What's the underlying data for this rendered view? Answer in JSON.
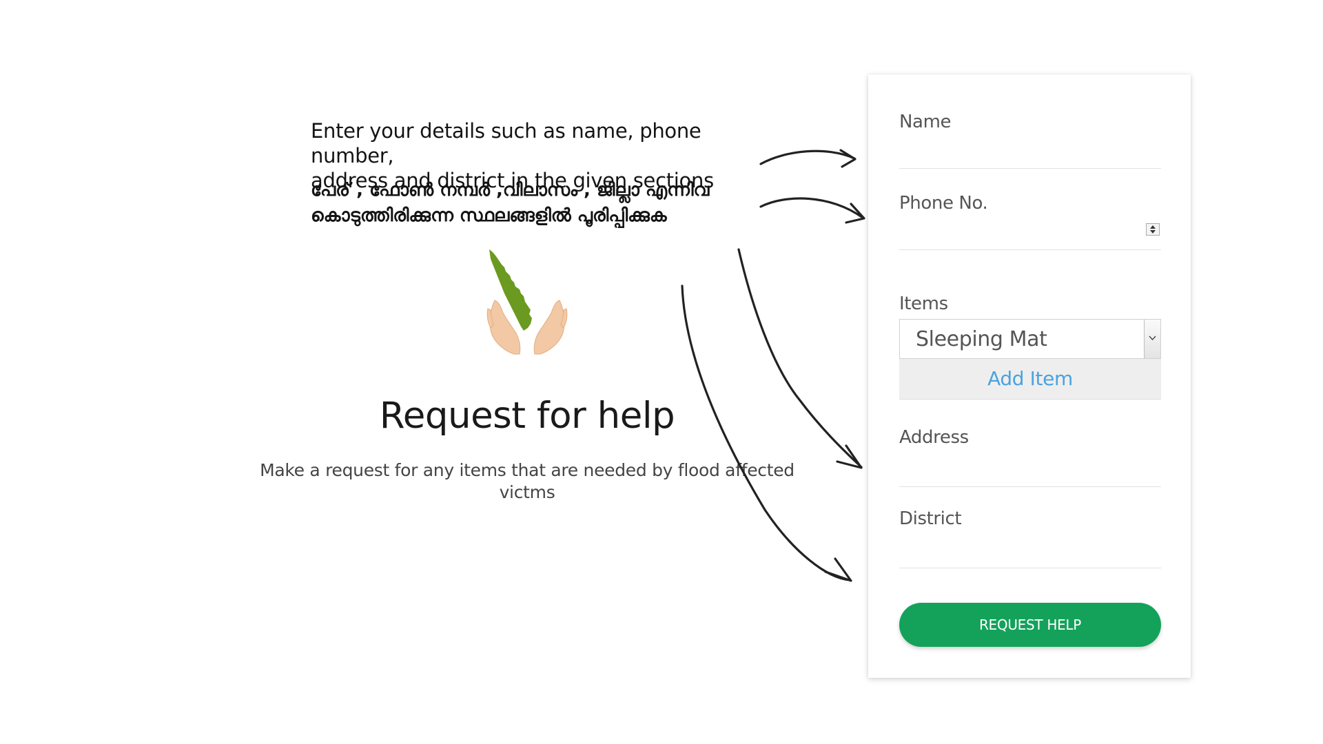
{
  "instructions": {
    "english_line1": "Enter your details such as name, phone number,",
    "english_line2": "address and district in the given sections",
    "malayalam_line1": "പേര് , ഫോൺ നമ്പർ ,വിലാസം , ജില്ലാ എന്നിവ",
    "malayalam_line2": "കൊടുത്തിരിക്കുന്ന സ്ഥലങ്ങളിൽ പൂരിപ്പിക്കുക"
  },
  "hero": {
    "icon": "kerala-in-hands-icon",
    "title": "Request for help",
    "subtitle": "Make a request for any items that are needed by flood affected victms"
  },
  "form": {
    "name_label": "Name",
    "name_value": "",
    "phone_label": "Phone No.",
    "phone_value": "",
    "items_label": "Items",
    "items_selected": "Sleeping Mat",
    "add_item_label": "Add Item",
    "address_label": "Address",
    "address_value": "",
    "district_label": "District",
    "district_value": "",
    "submit_label": "REQUEST HELP"
  },
  "colors": {
    "accent_green": "#14a25b",
    "link_blue": "#4aa3df",
    "kerala_green": "#6a9a1f",
    "hand_skin": "#f2c9a4"
  }
}
